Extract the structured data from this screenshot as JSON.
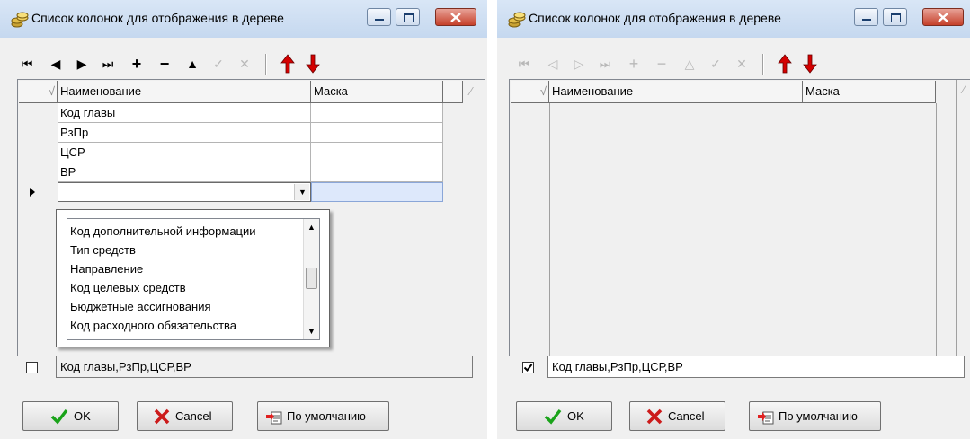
{
  "window_title": "Список колонок для отображения в дереве",
  "grid": {
    "col_name_header": "Наименование",
    "col_mask_header": "Маска",
    "rows": [
      "Код главы",
      "РзПр",
      "ЦСР",
      "ВР"
    ]
  },
  "dropdown": {
    "items": [
      "Код дополнительной информации",
      "Тип средств",
      "Направление",
      "Код целевых средств",
      "Бюджетные ассигнования",
      "Код расходного обязательства"
    ]
  },
  "summary_value": "Код главы,РзПр,ЦСР,ВР",
  "buttons": {
    "ok": "OK",
    "cancel": "Cancel",
    "default": "По умолчанию"
  },
  "left_panel": {
    "checkbox_checked": false,
    "nav_enabled": true
  },
  "right_panel": {
    "checkbox_checked": true,
    "nav_enabled": false
  },
  "colors": {
    "titlebar": "#c5d8ef",
    "close_button": "#c5402a",
    "arrow_red": "#d40000",
    "ok_check": "#1aa31a",
    "cancel_x": "#cc1b1b"
  },
  "icons": [
    "coins-icon",
    "first-record-icon",
    "prior-icon",
    "next-icon",
    "last-record-icon",
    "insert-icon",
    "delete-icon",
    "edit-icon",
    "post-icon",
    "cancel-edit-icon",
    "move-up-icon",
    "move-down-icon",
    "check-icon",
    "x-icon",
    "reset-default-icon"
  ]
}
